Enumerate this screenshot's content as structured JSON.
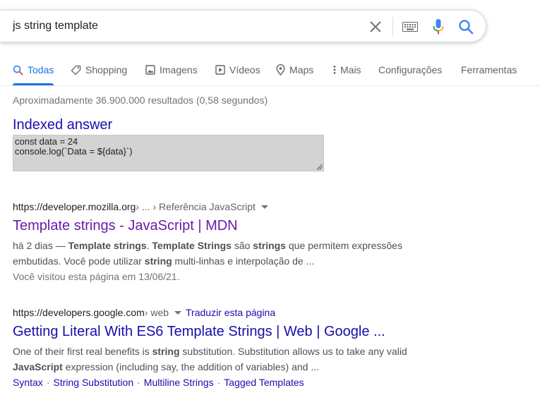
{
  "search": {
    "value": "js string template"
  },
  "icons": {
    "clear": "close-icon",
    "keyboard": "keyboard-icon",
    "mic": "microphone-icon",
    "search": "search-icon"
  },
  "colors": {
    "link": "#1a0dab",
    "visited": "#681da8",
    "accent": "#1a73e8"
  },
  "tabs": [
    {
      "label": "Todas",
      "icon": "search-icon",
      "active": true
    },
    {
      "label": "Shopping",
      "icon": "tag-icon"
    },
    {
      "label": "Imagens",
      "icon": "image-icon"
    },
    {
      "label": "Vídeos",
      "icon": "play-icon"
    },
    {
      "label": "Maps",
      "icon": "location-pin-icon"
    },
    {
      "label": "Mais",
      "icon": "more-vertical-icon"
    },
    {
      "label": "Configurações"
    },
    {
      "label": "Ferramentas"
    }
  ],
  "stats": "Aproximadamente 36.900.000 resultados (0,58 segundos)",
  "indexed": {
    "title": "Indexed answer",
    "code": [
      "const data = 24",
      "console.log(`Data = ${data}`)"
    ]
  },
  "results": [
    {
      "domain": "https://developer.mozilla.org",
      "path": " › ... › Referência JavaScript",
      "title": "Template strings - JavaScript | MDN",
      "snippet1": [
        {
          "t": "há 2 dias — "
        },
        {
          "t": "Template strings",
          "b": true
        },
        {
          "t": ". "
        },
        {
          "t": "Template Strings",
          "b": true
        },
        {
          "t": " são "
        },
        {
          "t": "strings",
          "b": true
        },
        {
          "t": " que permitem expressões"
        }
      ],
      "snippet2": [
        {
          "t": "embutidas. Você pode utilizar "
        },
        {
          "t": "string",
          "b": true
        },
        {
          "t": " multi-linhas e interpolação de ..."
        }
      ],
      "visited_note": "Você visitou esta página em 13/06/21."
    },
    {
      "domain": "https://developers.google.com",
      "path": " › web",
      "translate": "Traduzir esta página",
      "title": "Getting Literal With ES6 Template Strings | Web | Google ...",
      "snippet1": [
        {
          "t": "One of their first real benefits is "
        },
        {
          "t": "string",
          "b": true
        },
        {
          "t": " substitution. Substitution allows us to take any valid"
        }
      ],
      "snippet2": [
        {
          "t": "JavaScript",
          "b": true
        },
        {
          "t": " expression (including say, the addition of variables) and ..."
        }
      ],
      "sitelinks": [
        "Syntax",
        "String Substitution",
        "Multiline Strings",
        "Tagged Templates"
      ]
    }
  ]
}
